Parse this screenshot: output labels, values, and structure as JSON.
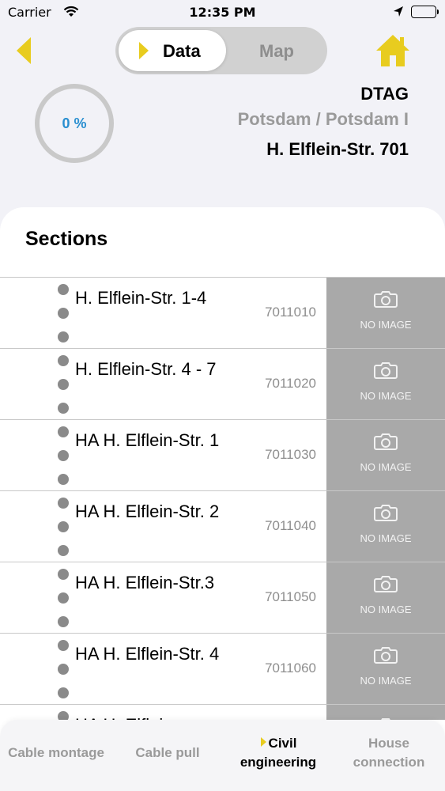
{
  "status_bar": {
    "carrier": "Carrier",
    "time": "12:35 PM"
  },
  "nav": {
    "segment_data": "Data",
    "segment_map": "Map"
  },
  "progress": {
    "label": "0 %",
    "value": 0
  },
  "project": {
    "company": "DTAG",
    "city": "Potsdam / Potsdam I",
    "street": "H. Elflein-Str. 701"
  },
  "sections": {
    "title": "Sections",
    "items": [
      {
        "name": "H. Elflein-Str. 1-4",
        "code": "7011010",
        "image_label": "NO IMAGE"
      },
      {
        "name": "H. Elflein-Str. 4 - 7",
        "code": "7011020",
        "image_label": "NO IMAGE"
      },
      {
        "name": "HA H. Elflein-Str. 1",
        "code": "7011030",
        "image_label": "NO IMAGE"
      },
      {
        "name": "HA H. Elflein-Str. 2",
        "code": "7011040",
        "image_label": "NO IMAGE"
      },
      {
        "name": "HA H. Elflein-Str.3",
        "code": "7011050",
        "image_label": "NO IMAGE"
      },
      {
        "name": "HA H. Elflein-Str. 4",
        "code": "7011060",
        "image_label": "NO IMAGE"
      },
      {
        "name": "HA H. Elflein-",
        "code": "",
        "image_label": ""
      }
    ]
  },
  "tabs": {
    "cable_montage": "Cable montage",
    "cable_pull": "Cable pull",
    "civil_line1": "Civil",
    "civil_line2": "engineering",
    "house_line1": "House",
    "house_line2": "connection"
  },
  "colors": {
    "accent_yellow": "#e8cc1f",
    "progress_blue": "#2a8fd0",
    "image_placeholder": "#a9a9a9"
  }
}
